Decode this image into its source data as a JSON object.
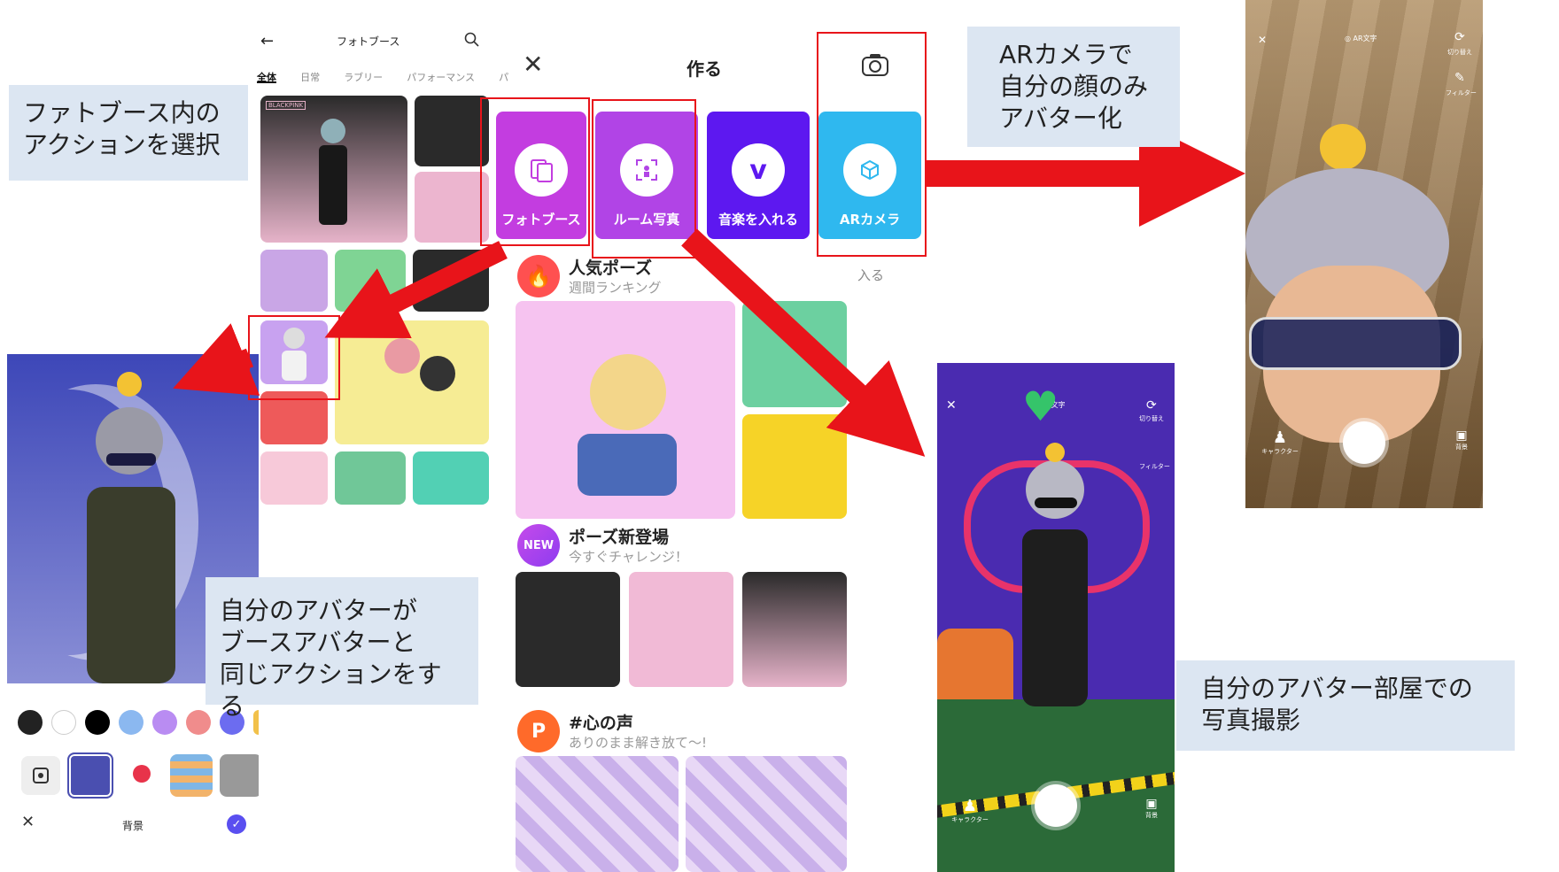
{
  "notes": {
    "photobooth_select": "ファトブース内の\nアクションを選択",
    "ar_camera": "ARカメラで\n自分の顔のみ\nアバター化",
    "same_action": "自分のアバターが\nブースアバターと\n同じアクションをする",
    "room_photo": "自分のアバター部屋での\n写真撮影"
  },
  "photobooth": {
    "title": "フォトブース",
    "tabs": [
      "全体",
      "日常",
      "ラブリー",
      "パフォーマンス",
      "パ"
    ],
    "blackpink_label": "BLACKPINK"
  },
  "create": {
    "title": "作る",
    "cards": [
      {
        "label": "フォトブース",
        "color": "#c33de0"
      },
      {
        "label": "ルーム写真",
        "color": "#b144e6"
      },
      {
        "label": "音楽を入れる",
        "color": "#5d18f0"
      },
      {
        "label": "ARカメラ",
        "color": "#2fb8ef"
      }
    ],
    "popular": {
      "title": "人気ポーズ",
      "sub": "週間ランキング",
      "enter": "入る"
    },
    "new_pose": {
      "badge": "NEW",
      "title": "ポーズ新登場",
      "sub": "今すぐチャレンジ！"
    },
    "voice": {
      "title": "#心の声",
      "sub": "ありのまま解き放て〜!"
    }
  },
  "background_panel": {
    "label": "背景",
    "swatches": [
      "#222222",
      "#ffffff",
      "#000000",
      "#8bb8f0",
      "#b98cf2",
      "#f08c8c",
      "#6c6cf0",
      "#f2c14a"
    ]
  },
  "camera_overlay": {
    "ar_text": "AR文字",
    "switch": "切り替え",
    "filter": "フィルター",
    "character": "キャラクター",
    "background": "背景"
  },
  "colors": {
    "accent_red": "#e8141a",
    "note_bg": "#dce6f2"
  }
}
